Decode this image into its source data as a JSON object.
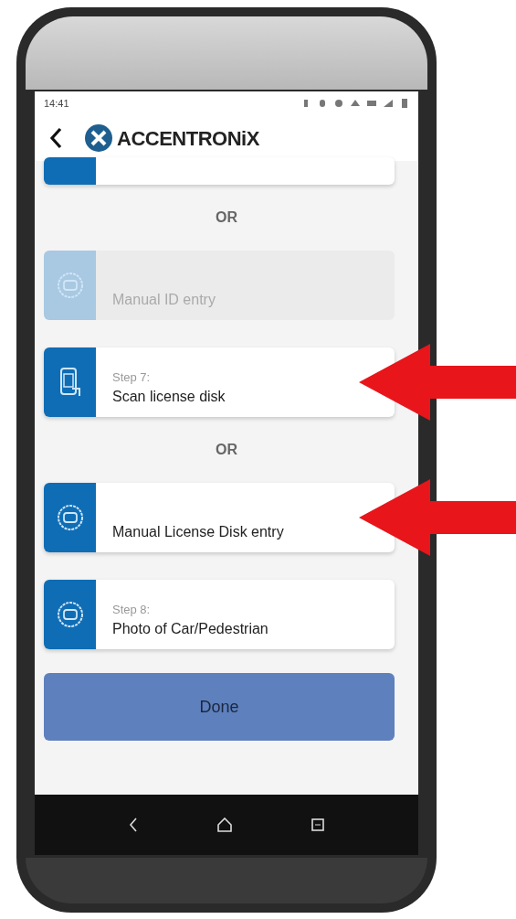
{
  "status_bar": {
    "time": "14:41"
  },
  "header": {
    "logo": "ACCENTRONiX"
  },
  "items": [
    {
      "kind": "clipped-card"
    },
    {
      "kind": "separator",
      "text": "OR"
    },
    {
      "kind": "entry-step",
      "title": "Manual ID entry",
      "disabled": true
    },
    {
      "kind": "scan-step",
      "step": "Step 7:",
      "title": "Scan license disk",
      "disabled": false,
      "pointed": true
    },
    {
      "kind": "separator",
      "text": "OR"
    },
    {
      "kind": "entry-step",
      "title": "Manual License Disk entry",
      "disabled": false,
      "pointed": true
    },
    {
      "kind": "entry-step",
      "step": "Step 8:",
      "title": "Photo of Car/Pedestrian",
      "disabled": false,
      "pointed": false
    }
  ],
  "done_button": {
    "label": "Done"
  }
}
